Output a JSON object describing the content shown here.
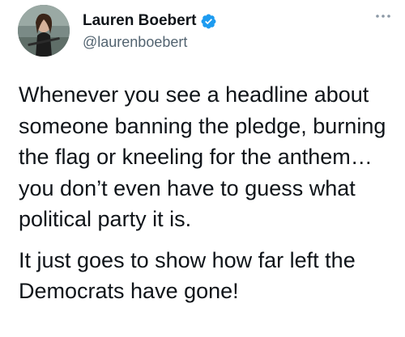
{
  "author": {
    "display_name": "Lauren Boebert",
    "handle": "@laurenboebert",
    "verified": true
  },
  "icons": {
    "verified": "verified-badge-icon",
    "more": "more-options-icon"
  },
  "colors": {
    "verified_badge": "#1d9bf0",
    "text_primary": "#0f1419",
    "text_secondary": "#536471",
    "icon_muted": "#8b98a5"
  },
  "tweet": {
    "paragraphs": [
      "Whenever you see a headline about someone banning the pledge, burning the flag or kneeling for the anthem… you don’t even have to guess what political party it is.",
      "It just goes to show how far left the Democrats have gone!"
    ]
  }
}
